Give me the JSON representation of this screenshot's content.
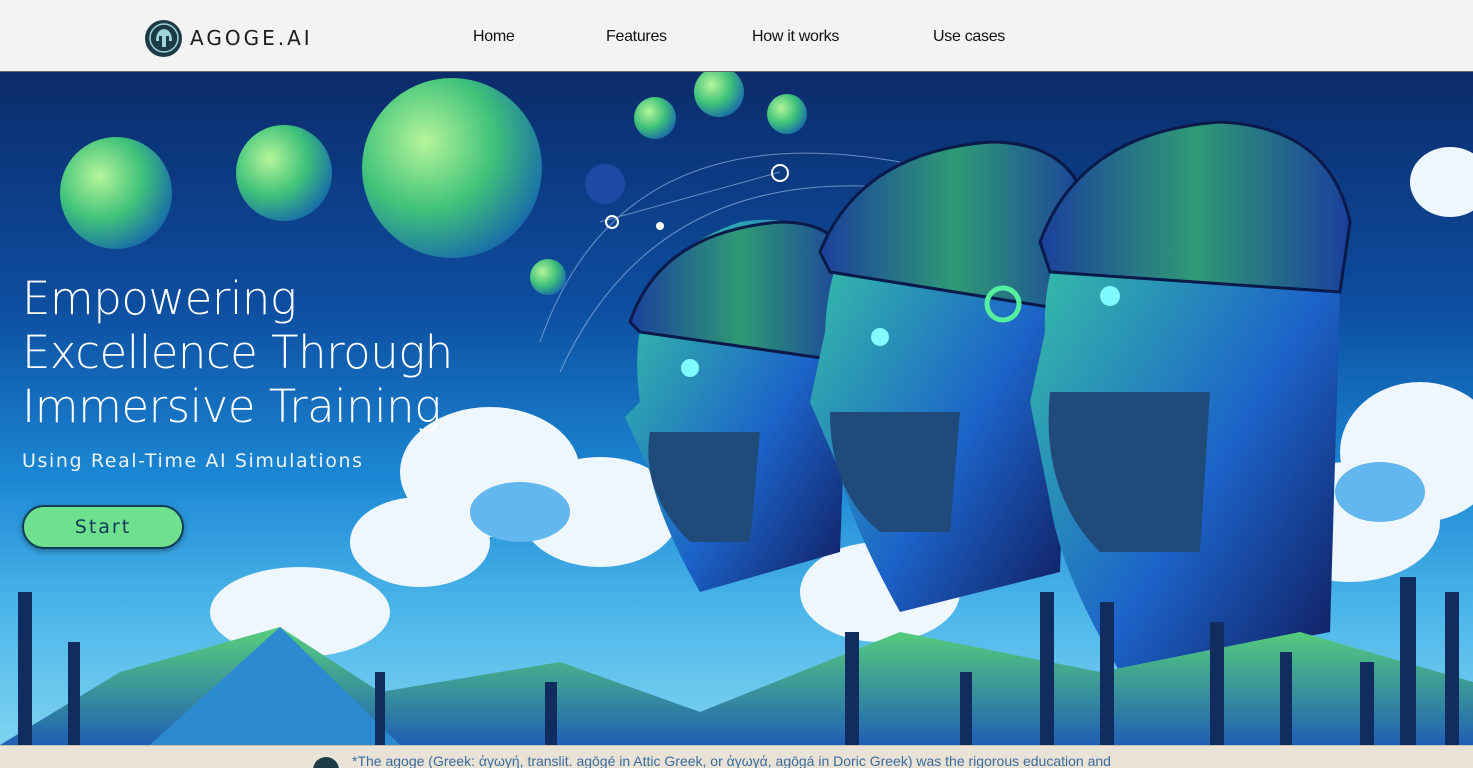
{
  "header": {
    "logo_text": "AGOGE.AI",
    "nav": [
      {
        "label": "Home"
      },
      {
        "label": "Features"
      },
      {
        "label": "How it works"
      },
      {
        "label": "Use cases"
      }
    ]
  },
  "hero": {
    "title": "Empowering Excellence Through Immersive Training",
    "subtitle": "Using Real-Time AI Simulations",
    "cta_label": "Start"
  },
  "footer": {
    "text": "*The agoge (Greek: ἀγωγή, translit. agōgé in Attic Greek, or ἀγωγά, agōgá in Doric Greek) was the rigorous education and"
  },
  "colors": {
    "accent": "#6fe08e",
    "header_bg": "#f3f3f3",
    "hero_sky": "#0d4ea0",
    "footer_bg": "#e9e2d6"
  },
  "icons": [
    "spartan-helmet-logo-icon"
  ]
}
